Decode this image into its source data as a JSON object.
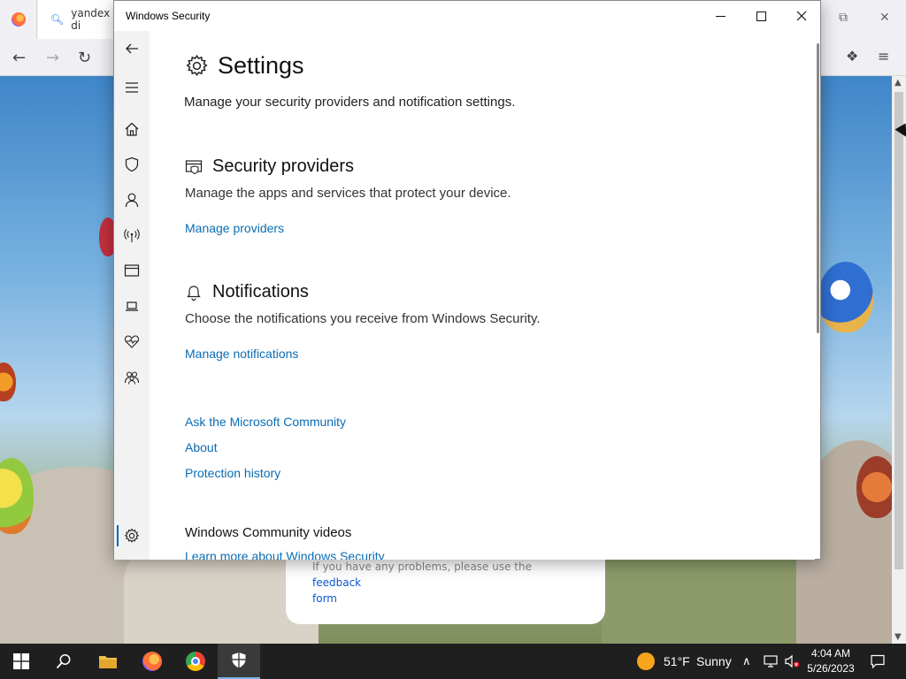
{
  "browser": {
    "tab_label": "yandex di",
    "card_text": "If you have any problems, please use the",
    "card_link": "feedback",
    "card_link2": "form"
  },
  "window": {
    "title": "Windows Security"
  },
  "page": {
    "title": "Settings",
    "description": "Manage your security providers and notification settings."
  },
  "sections": {
    "providers": {
      "title": "Security providers",
      "description": "Manage the apps and services that protect your device.",
      "link": "Manage providers"
    },
    "notifications": {
      "title": "Notifications",
      "description": "Choose the notifications you receive from Windows Security.",
      "link": "Manage notifications"
    }
  },
  "links": {
    "community": "Ask the Microsoft Community",
    "about": "About",
    "history": "Protection history"
  },
  "videos": {
    "heading": "Windows Community videos",
    "link": "Learn more about Windows Security"
  },
  "sidebar": {
    "icons": [
      "back-icon",
      "menu-icon",
      "home-icon",
      "shield-icon",
      "account-icon",
      "network-icon",
      "app-browser-icon",
      "device-icon",
      "health-icon",
      "family-icon",
      "gear-icon"
    ]
  },
  "taskbar": {
    "weather_temp": "51°F",
    "weather_text": "Sunny",
    "time": "4:04 AM",
    "date": "5/26/2023"
  },
  "colors": {
    "link": "#0a6cb5",
    "accent": "#0067c0",
    "taskbar": "#1f1f1f"
  }
}
